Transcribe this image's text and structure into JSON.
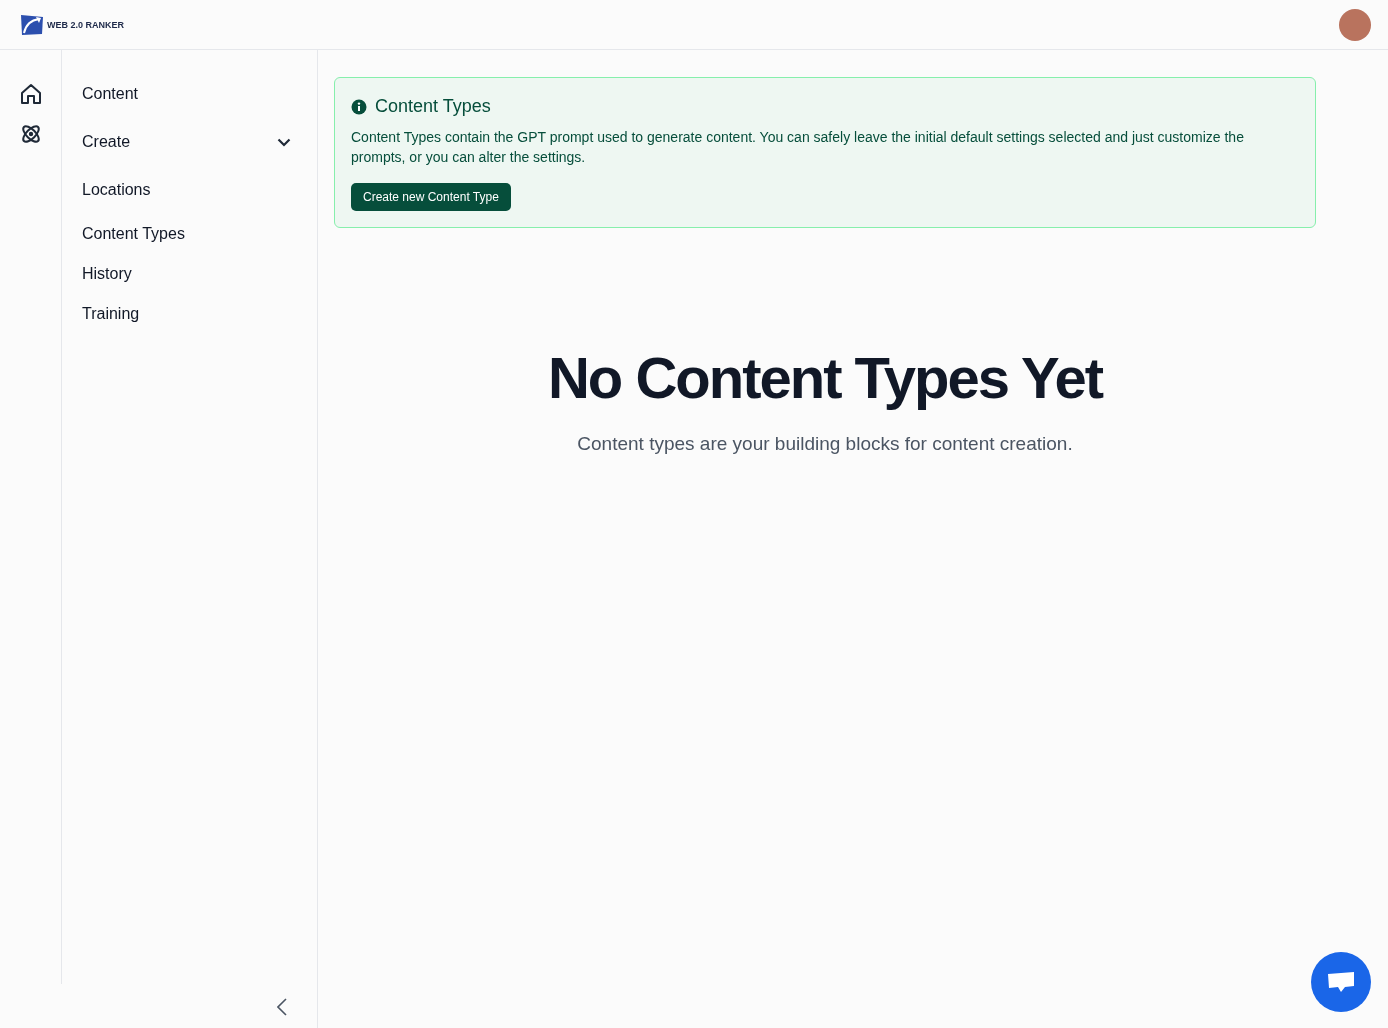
{
  "header": {
    "logo_text": "WEB 2.0 RANKER"
  },
  "nav": [
    {
      "label": "Content"
    },
    {
      "label": "Create",
      "expanded": false
    },
    {
      "label": "Locations"
    },
    {
      "label": "Content Types"
    },
    {
      "label": "History"
    },
    {
      "label": "Training"
    }
  ],
  "info_panel": {
    "title": "Content Types",
    "text": "Content Types contain the GPT prompt used to generate content. You can safely leave the initial default settings selected and just customize the prompts, or you can alter the settings.",
    "button": "Create new Content Type"
  },
  "empty_state": {
    "title": "No Content Types Yet",
    "subtitle": "Content types are your building blocks for content creation."
  }
}
